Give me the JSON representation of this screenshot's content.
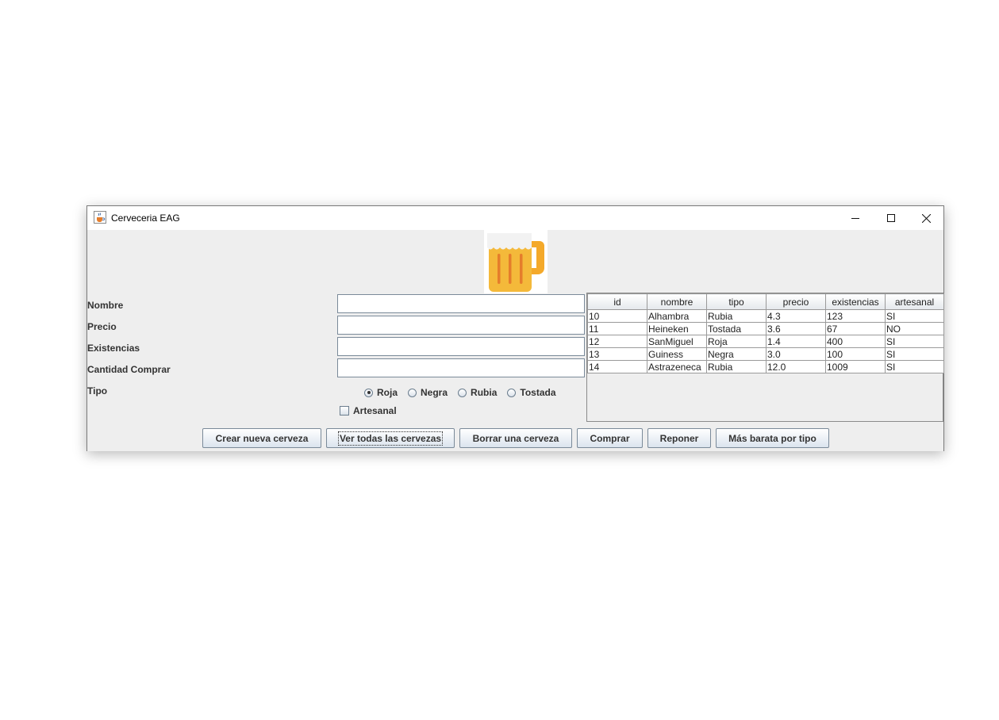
{
  "window": {
    "title": "Cerveceria EAG",
    "app_icon": "java-coffee-icon"
  },
  "window_controls": {
    "minimize_icon": "minimize-icon",
    "maximize_icon": "maximize-icon",
    "close_icon": "close-icon"
  },
  "image": {
    "icon": "beer-mug-icon",
    "colors": {
      "beer": "#f4b93a",
      "foam": "#f2f2f2",
      "handle": "#f4a92a",
      "stripes": "#e57d2b"
    }
  },
  "form": {
    "labels": {
      "nombre": "Nombre",
      "precio": "Precio",
      "existencias": "Existencias",
      "cantidad": "Cantidad Comprar",
      "tipo": "Tipo"
    },
    "values": {
      "nombre": "",
      "precio": "",
      "existencias": "",
      "cantidad": ""
    },
    "tipo_options": [
      {
        "label": "Roja",
        "checked": true
      },
      {
        "label": "Negra",
        "checked": false
      },
      {
        "label": "Rubia",
        "checked": false
      },
      {
        "label": "Tostada",
        "checked": false
      }
    ],
    "artesanal": {
      "label": "Artesanal",
      "checked": false
    }
  },
  "table": {
    "columns": [
      "id",
      "nombre",
      "tipo",
      "precio",
      "existencias",
      "artesanal"
    ],
    "rows": [
      [
        "10",
        "Alhambra",
        "Rubia",
        "4.3",
        "123",
        "SI"
      ],
      [
        "11",
        "Heineken",
        "Tostada",
        "3.6",
        "67",
        "NO"
      ],
      [
        "12",
        "SanMiguel",
        "Roja",
        "1.4",
        "400",
        "SI"
      ],
      [
        "13",
        "Guiness",
        "Negra",
        "3.0",
        "100",
        "SI"
      ],
      [
        "14",
        "Astrazeneca",
        "Rubia",
        "12.0",
        "1009",
        "SI"
      ]
    ]
  },
  "buttons": {
    "crear": "Crear nueva cerveza",
    "ver": "Ver todas las cervezas",
    "borrar": "Borrar una cerveza",
    "comprar": "Comprar",
    "reponer": "Reponer",
    "barata": "Más barata por tipo"
  },
  "colors": {
    "window_bg": "#eeeeee",
    "button_border": "#7a8a99",
    "field_border": "#7a8a99"
  }
}
